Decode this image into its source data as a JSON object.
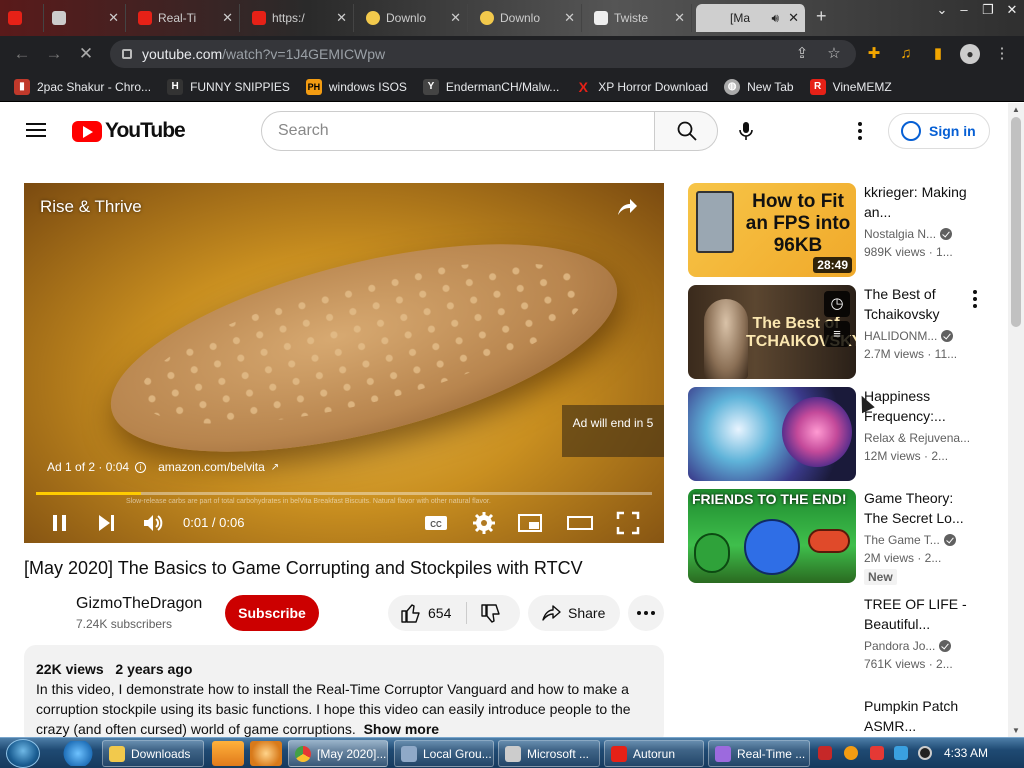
{
  "browser": {
    "tabs": [
      {
        "title": "",
        "icon_color": "#e62117"
      },
      {
        "title": "",
        "icon_color": "#cccccc"
      },
      {
        "title": "Real-Ti",
        "icon_color": "#e62117"
      },
      {
        "title": "https:/",
        "icon_color": "#e62117"
      },
      {
        "title": "Downlo",
        "icon_color": "#f2c94c"
      },
      {
        "title": "Downlo",
        "icon_color": "#f2c94c"
      },
      {
        "title": "Twiste",
        "icon_color": "#eeeeee"
      },
      {
        "title": "[Ma",
        "icon_color": "#e62117"
      }
    ],
    "url_host": "youtube.com",
    "url_path": "/watch?v=1J4GEMICWpw",
    "bookmarks": [
      {
        "label": "2pac Shakur - Chro...",
        "icon": "book-icon",
        "color": "#c0392b"
      },
      {
        "label": "FUNNY SNIPPIES",
        "icon": "H",
        "color": "#333333"
      },
      {
        "label": "windows ISOS",
        "icon": "PH",
        "color": "#f39c12"
      },
      {
        "label": "EndermanCH/Malw...",
        "icon": "Y",
        "color": "#444444"
      },
      {
        "label": "XP Horror Download",
        "icon": "X",
        "color": "#e62117"
      },
      {
        "label": "New Tab",
        "icon": "globe-icon",
        "color": "#aaaaaa"
      },
      {
        "label": "VineMEMZ",
        "icon": "R",
        "color": "#e62117"
      }
    ]
  },
  "youtube": {
    "logo_text": "YouTube",
    "search_placeholder": "Search",
    "signin_label": "Sign in",
    "player": {
      "title": "Rise & Thrive",
      "ad_info": "Ad 1 of 2 · 0:04",
      "ad_link": "amazon.com/belvita",
      "ad_skip": "Ad will end in 5",
      "fine_print": "Slow-release carbs are part of total carbohydrates in belVita Breakfast Biscuits. Natural flavor with other natural flavor.",
      "time": "0:01 / 0:06",
      "progress": 0.17
    },
    "video": {
      "title": "[May 2020] The Basics to Game Corrupting and Stockpiles with RTCV",
      "channel": "GizmoTheDragon",
      "subscribers": "7.24K subscribers",
      "subscribe_label": "Subscribe",
      "likes": "654",
      "share_label": "Share",
      "views": "22K views",
      "age": "2 years ago",
      "description": "In this video, I demonstrate how to install the Real-Time Corruptor Vanguard and how to make a corruption stockpile using its basic functions. I hope this video can easily introduce people to the crazy (and often cursed) world of game corruptions.",
      "show_more": "Show more"
    },
    "recommendations": [
      {
        "title": "kkrieger: Making an...",
        "channel": "Nostalgia N...",
        "views": "989K views · 1...",
        "duration": "28:49",
        "thumb_text": "How to Fit an FPS into 96KB",
        "verified": true
      },
      {
        "title": "The Best of Tchaikovsky",
        "channel": "HALIDONM...",
        "views": "2.7M views · 11...",
        "duration": "",
        "thumb_text": "The Best of TCHAIKOVSKY",
        "verified": true
      },
      {
        "title": "Happiness Frequency:...",
        "channel": "Relax & Rejuvena...",
        "views": "12M views · 2...",
        "duration": "",
        "thumb_text": "",
        "verified": false
      },
      {
        "title": "Game Theory: The Secret Lo...",
        "channel": "The Game T...",
        "views": "2M views · 2...",
        "duration": "",
        "thumb_text": "FRIENDS TO THE END!",
        "verified": true,
        "badge": "New"
      },
      {
        "title": "TREE OF LIFE - Beautiful...",
        "channel": "Pandora Jo...",
        "views": "761K views · 2...",
        "verified": true
      },
      {
        "title": "Pumpkin Patch ASMR...",
        "channel": "",
        "views": "",
        "verified": false
      }
    ]
  },
  "taskbar": {
    "tasks": [
      {
        "label": "Downloads",
        "color": "#f2c94c"
      },
      {
        "label": "[May 2020]...",
        "color": "#4caf50"
      },
      {
        "label": "Local Grou...",
        "color": "#8fa9c8"
      },
      {
        "label": "Microsoft ...",
        "color": "#cccccc"
      },
      {
        "label": "Autorun",
        "color": "#e62117"
      },
      {
        "label": "Real-Time ...",
        "color": "#9c6ade"
      }
    ],
    "clock": "4:33 AM"
  }
}
